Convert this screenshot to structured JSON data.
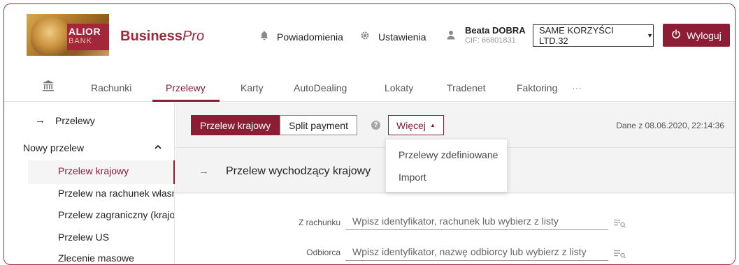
{
  "header": {
    "logo": {
      "line1": "ALIOR",
      "line2": "BANK"
    },
    "product_bold": "Business",
    "product_italic": "Pro",
    "notifications_label": "Powiadomienia",
    "settings_label": "Ustawienia",
    "user_name": "Beata DOBRA",
    "user_cif": "CIF: 66801831",
    "company_select": "SAME KORZYŚCI LTD.32",
    "logout_label": "Wyloguj"
  },
  "nav": {
    "items": [
      "Rachunki",
      "Przelewy",
      "Karty",
      "AutoDealing",
      "Lokaty",
      "Tradenet",
      "Faktoring"
    ],
    "more": "···",
    "active": "Przelewy"
  },
  "sidebar": {
    "top_link": "Przelewy",
    "group": "Nowy przelew",
    "items": [
      "Przelew krajowy",
      "Przelew na rachunek własny",
      "Przelew zagraniczny (krajowy)",
      "Przelew US",
      "Zlecenie masowe"
    ],
    "active": "Przelew krajowy"
  },
  "main": {
    "tabs": [
      "Przelew krajowy",
      "Split payment"
    ],
    "help": "?",
    "more_button": "Więcej",
    "data_date": "Dane z 08.06.2020, 22:14:36",
    "card_title": "Przelew wychodzący krajowy",
    "form": {
      "from_label": "Z rachunku",
      "from_placeholder": "Wpisz identyfikator, rachunek lub wybierz z listy",
      "to_label": "Odbiorca",
      "to_placeholder": "Wpisz identyfikator, nazwę odbiorcy lub wybierz z listy"
    }
  },
  "dropdown": {
    "items": [
      "Przelewy zdefiniowane",
      "Import"
    ]
  },
  "colors": {
    "brand": "#8c1d35",
    "accent_border": "#a3263a"
  }
}
